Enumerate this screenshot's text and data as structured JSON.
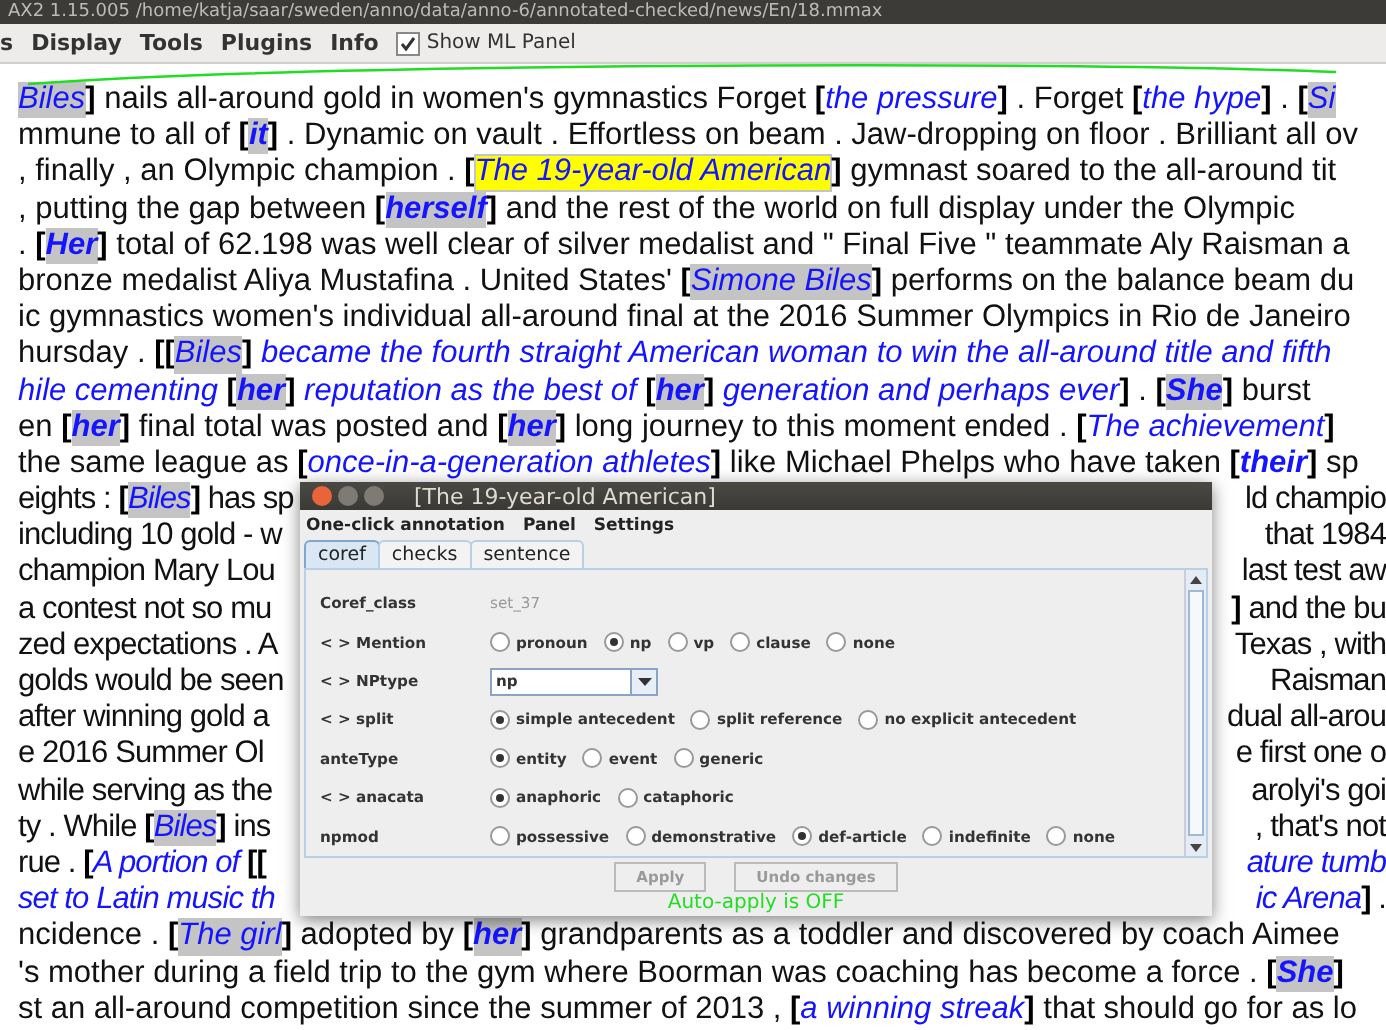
{
  "window": {
    "title": "AX2 1.15.005 /home/katja/saar/sweden/anno/data/anno-6/annotated-checked/news/En/18.mmax"
  },
  "menu": {
    "items": [
      "s",
      "Display",
      "Tools",
      "Plugins",
      "Info"
    ],
    "toggle": {
      "label": "Show ML Panel",
      "checked": true
    }
  },
  "document": {
    "lines": [
      {
        "left": [
          {
            "kind": "mention",
            "text": "Biles",
            "highlighted": true,
            "selected": false,
            "bold": false
          },
          {
            "kind": "bracket",
            "text": "]"
          },
          {
            "kind": "text",
            "text": " nails all-around gold in women's gymnastics Forget "
          },
          {
            "kind": "bracket",
            "text": "["
          },
          {
            "kind": "mention",
            "text": "the pressure",
            "highlighted": false,
            "selected": false,
            "bold": false
          },
          {
            "kind": "bracket",
            "text": "]"
          },
          {
            "kind": "text",
            "text": " . Forget "
          },
          {
            "kind": "bracket",
            "text": "["
          },
          {
            "kind": "mention",
            "text": "the hype",
            "highlighted": false,
            "selected": false,
            "bold": false
          },
          {
            "kind": "bracket",
            "text": "]"
          },
          {
            "kind": "text",
            "text": " . "
          },
          {
            "kind": "bracket",
            "text": "["
          },
          {
            "kind": "mention",
            "text": "Si",
            "highlighted": true,
            "selected": false,
            "bold": false
          }
        ]
      },
      {
        "left": [
          {
            "kind": "text",
            "text": "mmune to all of "
          },
          {
            "kind": "bracket",
            "text": "["
          },
          {
            "kind": "mention",
            "text": "it",
            "highlighted": true,
            "selected": false,
            "bold": true
          },
          {
            "kind": "bracket",
            "text": "]"
          },
          {
            "kind": "text",
            "text": " . Dynamic on vault . Effortless on beam . Jaw-dropping on floor . Brilliant all ov"
          }
        ]
      },
      {
        "left": [
          {
            "kind": "text",
            "text": ", finally , an Olympic champion . "
          },
          {
            "kind": "bracket",
            "text": "["
          },
          {
            "kind": "mention",
            "text": "The 19-year-old American",
            "highlighted": true,
            "selected": true,
            "bold": false
          },
          {
            "kind": "bracket",
            "text": "]"
          },
          {
            "kind": "text",
            "text": " gymnast soared to the all-around tit"
          }
        ]
      },
      {
        "left": [
          {
            "kind": "text",
            "text": ", putting the gap between "
          },
          {
            "kind": "bracket",
            "text": "["
          },
          {
            "kind": "mention",
            "text": "herself",
            "highlighted": true,
            "selected": false,
            "bold": true
          },
          {
            "kind": "bracket",
            "text": "]"
          },
          {
            "kind": "text",
            "text": " and the rest of the world on full display under the Olympic"
          }
        ]
      },
      {
        "left": [
          {
            "kind": "text",
            "text": ". "
          },
          {
            "kind": "bracket",
            "text": "["
          },
          {
            "kind": "mention",
            "text": "Her",
            "highlighted": true,
            "selected": false,
            "bold": true
          },
          {
            "kind": "bracket",
            "text": "]"
          },
          {
            "kind": "text",
            "text": " total of 62.198 was well clear of silver medalist and \" Final Five \" teammate Aly Raisman a"
          }
        ]
      },
      {
        "left": [
          {
            "kind": "text",
            "text": "bronze medalist Aliya Mustafina . United States' "
          },
          {
            "kind": "bracket",
            "text": "["
          },
          {
            "kind": "mention",
            "text": "Simone Biles",
            "highlighted": true,
            "selected": false,
            "bold": false
          },
          {
            "kind": "bracket",
            "text": "]"
          },
          {
            "kind": "text",
            "text": " performs on the balance beam du"
          }
        ]
      },
      {
        "left": [
          {
            "kind": "text",
            "text": "ic gymnastics women's individual all-around final at the 2016 Summer Olympics in Rio de Janeiro"
          }
        ]
      },
      {
        "left": [
          {
            "kind": "text",
            "text": "hursday . "
          },
          {
            "kind": "bracket",
            "text": "[["
          },
          {
            "kind": "mention",
            "text": "Biles",
            "highlighted": true,
            "selected": false,
            "bold": false
          },
          {
            "kind": "bracket",
            "text": "]"
          },
          {
            "kind": "mention",
            "text": " became the fourth straight American woman to win the all-around title and fifth",
            "highlighted": false,
            "selected": false,
            "bold": false
          }
        ]
      },
      {
        "left": [
          {
            "kind": "mention",
            "text": "hile cementing ",
            "highlighted": false,
            "selected": false,
            "bold": false
          },
          {
            "kind": "bracket",
            "text": "["
          },
          {
            "kind": "mention",
            "text": "her",
            "highlighted": true,
            "selected": false,
            "bold": true
          },
          {
            "kind": "bracket",
            "text": "]"
          },
          {
            "kind": "mention",
            "text": " reputation as the best of ",
            "highlighted": false,
            "selected": false,
            "bold": false
          },
          {
            "kind": "bracket",
            "text": "["
          },
          {
            "kind": "mention",
            "text": "her",
            "highlighted": true,
            "selected": false,
            "bold": true
          },
          {
            "kind": "bracket",
            "text": "]"
          },
          {
            "kind": "mention",
            "text": " generation and perhaps ever",
            "highlighted": false,
            "selected": false,
            "bold": false
          },
          {
            "kind": "bracket",
            "text": "]"
          },
          {
            "kind": "text",
            "text": " . "
          },
          {
            "kind": "bracket",
            "text": "["
          },
          {
            "kind": "mention",
            "text": "She",
            "highlighted": true,
            "selected": false,
            "bold": true
          },
          {
            "kind": "bracket",
            "text": "]"
          },
          {
            "kind": "text",
            "text": " burst"
          }
        ]
      },
      {
        "left": [
          {
            "kind": "text",
            "text": "en "
          },
          {
            "kind": "bracket",
            "text": "["
          },
          {
            "kind": "mention",
            "text": "her",
            "highlighted": true,
            "selected": false,
            "bold": true
          },
          {
            "kind": "bracket",
            "text": "]"
          },
          {
            "kind": "text",
            "text": " final total was posted and "
          },
          {
            "kind": "bracket",
            "text": "["
          },
          {
            "kind": "mention",
            "text": "her",
            "highlighted": true,
            "selected": false,
            "bold": true
          },
          {
            "kind": "bracket",
            "text": "]"
          },
          {
            "kind": "text",
            "text": " long journey to this moment ended . "
          },
          {
            "kind": "bracket",
            "text": "["
          },
          {
            "kind": "mention",
            "text": "The achievement",
            "highlighted": false,
            "selected": false,
            "bold": false
          },
          {
            "kind": "bracket",
            "text": "]"
          }
        ]
      },
      {
        "left": [
          {
            "kind": "text",
            "text": "the same league as "
          },
          {
            "kind": "bracket",
            "text": "["
          },
          {
            "kind": "mention",
            "text": "once-in-a-generation athletes",
            "highlighted": false,
            "selected": false,
            "bold": false
          },
          {
            "kind": "bracket",
            "text": "]"
          },
          {
            "kind": "text",
            "text": " like Michael Phelps who have taken "
          },
          {
            "kind": "bracket",
            "text": "["
          },
          {
            "kind": "mention",
            "text": "their",
            "highlighted": false,
            "selected": false,
            "bold": true
          },
          {
            "kind": "bracket",
            "text": "]"
          },
          {
            "kind": "text",
            "text": " sp"
          }
        ]
      },
      {
        "left": [
          {
            "kind": "text",
            "text": "eights : "
          },
          {
            "kind": "bracket",
            "text": "["
          },
          {
            "kind": "mention",
            "text": "Biles",
            "highlighted": true,
            "selected": false,
            "bold": false
          },
          {
            "kind": "bracket",
            "text": "]"
          },
          {
            "kind": "text",
            "text": " has sp"
          }
        ],
        "right": [
          {
            "kind": "text",
            "text": "ld champio"
          }
        ]
      },
      {
        "left": [
          {
            "kind": "text",
            "text": "including 10 gold - w"
          }
        ],
        "right": [
          {
            "kind": "text",
            "text": "that 1984"
          }
        ]
      },
      {
        "left": [
          {
            "kind": "text",
            "text": "champion Mary Lou"
          }
        ],
        "right": [
          {
            "kind": "text",
            "text": "last test aw"
          }
        ]
      },
      {
        "left": [
          {
            "kind": "text",
            "text": "a contest not so mu"
          }
        ],
        "right": [
          {
            "kind": "bracket",
            "text": "]"
          },
          {
            "kind": "text",
            "text": " and the bu"
          }
        ]
      },
      {
        "left": [
          {
            "kind": "text",
            "text": "zed expectations . A"
          }
        ],
        "right": [
          {
            "kind": "text",
            "text": "Texas , with"
          }
        ]
      },
      {
        "left": [
          {
            "kind": "text",
            "text": "golds would be seen"
          }
        ],
        "right": [
          {
            "kind": "text",
            "text": "Raisman"
          }
        ]
      },
      {
        "left": [
          {
            "kind": "text",
            "text": "after winning gold a"
          }
        ],
        "right": [
          {
            "kind": "text",
            "text": "dual all-arou"
          }
        ]
      },
      {
        "left": [
          {
            "kind": "text",
            "text": "e 2016 Summer Ol"
          }
        ],
        "right": [
          {
            "kind": "text",
            "text": "e first one o"
          }
        ]
      },
      {
        "left": [
          {
            "kind": "text",
            "text": "while serving as the"
          }
        ],
        "right": [
          {
            "kind": "text",
            "text": "arolyi's goi"
          }
        ]
      },
      {
        "left": [
          {
            "kind": "text",
            "text": "ty . While "
          },
          {
            "kind": "bracket",
            "text": "["
          },
          {
            "kind": "mention",
            "text": "Biles",
            "highlighted": true,
            "selected": false,
            "bold": false
          },
          {
            "kind": "bracket",
            "text": "]"
          },
          {
            "kind": "text",
            "text": " ins"
          }
        ],
        "right": [
          {
            "kind": "text",
            "text": ", that's not"
          }
        ]
      },
      {
        "left": [
          {
            "kind": "text",
            "text": "rue . "
          },
          {
            "kind": "bracket",
            "text": "["
          },
          {
            "kind": "mention",
            "text": "A portion of ",
            "highlighted": false,
            "selected": false,
            "bold": false
          },
          {
            "kind": "bracket",
            "text": "[["
          }
        ],
        "right": [
          {
            "kind": "mention",
            "text": "ature tumb",
            "highlighted": false,
            "selected": false,
            "bold": false
          }
        ]
      },
      {
        "left": [
          {
            "kind": "mention",
            "text": "set to Latin music th",
            "highlighted": false,
            "selected": false,
            "bold": false
          }
        ],
        "right": [
          {
            "kind": "mention",
            "text": "ic Arena",
            "highlighted": false,
            "selected": false,
            "bold": false
          },
          {
            "kind": "bracket",
            "text": "]"
          },
          {
            "kind": "text",
            "text": " ."
          }
        ]
      },
      {
        "left": [
          {
            "kind": "text",
            "text": "ncidence . "
          },
          {
            "kind": "bracket",
            "text": "["
          },
          {
            "kind": "mention",
            "text": "The girl",
            "highlighted": true,
            "selected": false,
            "bold": false
          },
          {
            "kind": "bracket",
            "text": "]"
          },
          {
            "kind": "text",
            "text": " adopted by "
          },
          {
            "kind": "bracket",
            "text": "["
          },
          {
            "kind": "mention",
            "text": "her",
            "highlighted": true,
            "selected": false,
            "bold": true
          },
          {
            "kind": "bracket",
            "text": "]"
          },
          {
            "kind": "text",
            "text": " grandparents as a toddler and discovered by coach Aimee"
          }
        ]
      },
      {
        "left": [
          {
            "kind": "text",
            "text": "'s mother during a field trip to the gym where Boorman was coaching has become a force . "
          },
          {
            "kind": "bracket",
            "text": "["
          },
          {
            "kind": "mention",
            "text": "She",
            "highlighted": true,
            "selected": false,
            "bold": true
          },
          {
            "kind": "bracket",
            "text": "]"
          }
        ]
      },
      {
        "left": [
          {
            "kind": "text",
            "text": "st an all-around competition since the summer of 2013 , "
          },
          {
            "kind": "bracket",
            "text": "["
          },
          {
            "kind": "mention",
            "text": "a winning streak",
            "highlighted": false,
            "selected": false,
            "bold": false
          },
          {
            "kind": "bracket",
            "text": "]"
          },
          {
            "kind": "text",
            "text": " that should go for as lo"
          }
        ]
      }
    ]
  },
  "dialog": {
    "title": "[The 19-year-old American]",
    "menu": [
      "One-click annotation",
      "Panel",
      "Settings"
    ],
    "tabs": [
      {
        "label": "coref",
        "selected": true
      },
      {
        "label": "checks",
        "selected": false
      },
      {
        "label": "sentence",
        "selected": false
      }
    ],
    "rows": [
      {
        "kind": "value",
        "label": "Coref_class",
        "value": "set_37"
      },
      {
        "kind": "radio",
        "label": "< > Mention",
        "options": [
          {
            "label": "pronoun",
            "selected": false
          },
          {
            "label": "np",
            "selected": true
          },
          {
            "label": "vp",
            "selected": false
          },
          {
            "label": "clause",
            "selected": false
          },
          {
            "label": "none",
            "selected": false
          }
        ]
      },
      {
        "kind": "dropdown",
        "label": "< > NPtype",
        "value": "np"
      },
      {
        "kind": "radio",
        "label": "< > split",
        "options": [
          {
            "label": "simple antecedent",
            "selected": true
          },
          {
            "label": "split reference",
            "selected": false
          },
          {
            "label": "no explicit antecedent",
            "selected": false
          }
        ]
      },
      {
        "kind": "radio",
        "label": "anteType",
        "options": [
          {
            "label": "entity",
            "selected": true
          },
          {
            "label": "event",
            "selected": false
          },
          {
            "label": "generic",
            "selected": false
          }
        ]
      },
      {
        "kind": "radio",
        "label": "< > anacata",
        "options": [
          {
            "label": "anaphoric",
            "selected": true
          },
          {
            "label": "cataphoric",
            "selected": false
          }
        ]
      },
      {
        "kind": "radio",
        "label": "npmod",
        "options": [
          {
            "label": "possessive",
            "selected": false
          },
          {
            "label": "demonstrative",
            "selected": false
          },
          {
            "label": "def-article",
            "selected": true
          },
          {
            "label": "indefinite",
            "selected": false
          },
          {
            "label": "none",
            "selected": false
          }
        ]
      }
    ],
    "buttons": [
      {
        "label": "Apply",
        "disabled": true
      },
      {
        "label": "Undo changes",
        "disabled": true
      }
    ],
    "status": "Auto-apply is OFF"
  }
}
